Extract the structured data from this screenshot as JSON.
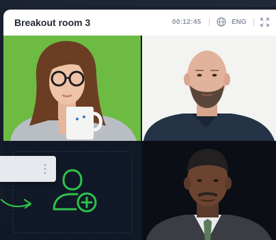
{
  "header": {
    "title": "Breakout room 3",
    "timer": "00:12:45",
    "language": "ENG"
  },
  "icons": {
    "globe": "globe-icon",
    "fullscreen": "fullscreen-icon",
    "invite": "add-user-icon",
    "menu": "more-vertical-icon",
    "arrow": "arrow-right-icon"
  },
  "colors": {
    "accent": "#2ec44a",
    "header_bg": "#ffffff",
    "window_bg": "#0e1522"
  }
}
